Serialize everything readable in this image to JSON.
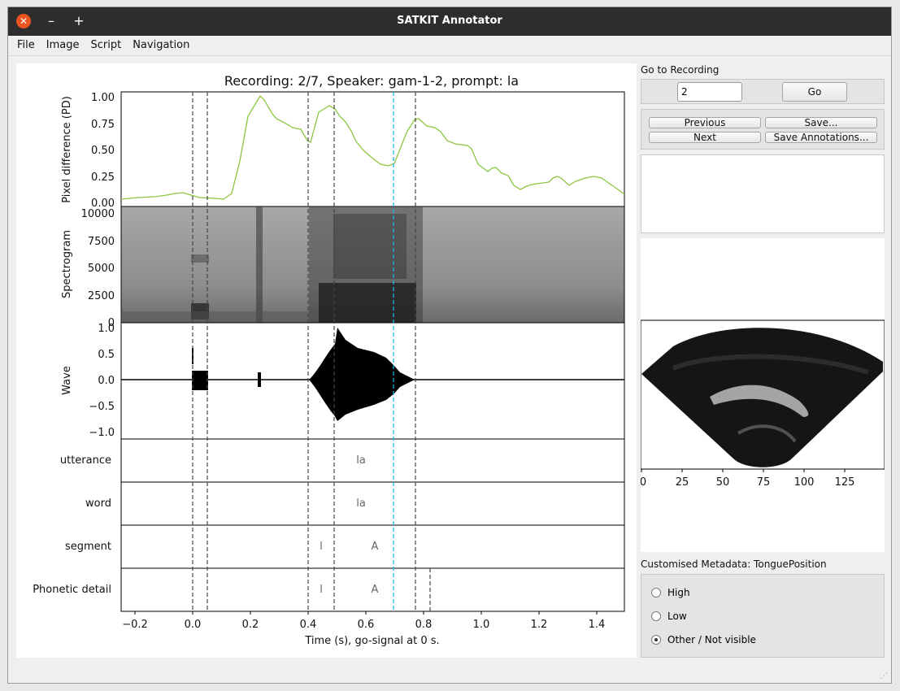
{
  "window": {
    "title": "SATKIT Annotator"
  },
  "titlebar": {
    "close_glyph": "✕",
    "minimize_glyph": "–",
    "maximize_glyph": "+"
  },
  "menu": [
    "File",
    "Image",
    "Script",
    "Navigation"
  ],
  "plot": {
    "title": "Recording: 2/7, Speaker: gam-1-2, prompt: la",
    "xlabel": "Time (s), go-signal at 0 s.",
    "xticks": [
      "−0.2",
      "0.0",
      "0.2",
      "0.4",
      "0.6",
      "0.8",
      "1.0",
      "1.2",
      "1.4"
    ],
    "pd": {
      "ylabel": "Pixel difference (PD)",
      "yticks": [
        "1.00",
        "0.75",
        "0.50",
        "0.25",
        "0.00"
      ],
      "color": "#8cc63f"
    },
    "spectrogram": {
      "ylabel": "Spectrogram",
      "yticks": [
        "10000",
        "7500",
        "5000",
        "2500",
        "0"
      ]
    },
    "wave": {
      "ylabel": "Wave",
      "yticks": [
        "1.0",
        "0.5",
        "0.0",
        "−0.5",
        "−1.0"
      ]
    },
    "tiers": [
      {
        "name": "utterance",
        "labels": [
          "la"
        ]
      },
      {
        "name": "word",
        "labels": [
          "la"
        ]
      },
      {
        "name": "segment",
        "labels": [
          "l",
          "A"
        ]
      },
      {
        "name": "Phonetic detail",
        "labels": [
          "l",
          "A"
        ]
      }
    ],
    "cursor_color": "#1fb3e6"
  },
  "side": {
    "goto_label": "Go to Recording",
    "goto_value": "2",
    "go_button": "Go",
    "previous_button": "Previous",
    "next_button": "Next",
    "save_button": "Save...",
    "save_annotations_button": "Save Annotations...",
    "ultrasound_xticks": [
      "0",
      "25",
      "50",
      "75",
      "100",
      "125"
    ],
    "metadata_label": "Customised Metadata: TonguePosition",
    "radio_options": [
      "High",
      "Low",
      "Other / Not visible"
    ],
    "radio_selected": "Other / Not visible"
  }
}
